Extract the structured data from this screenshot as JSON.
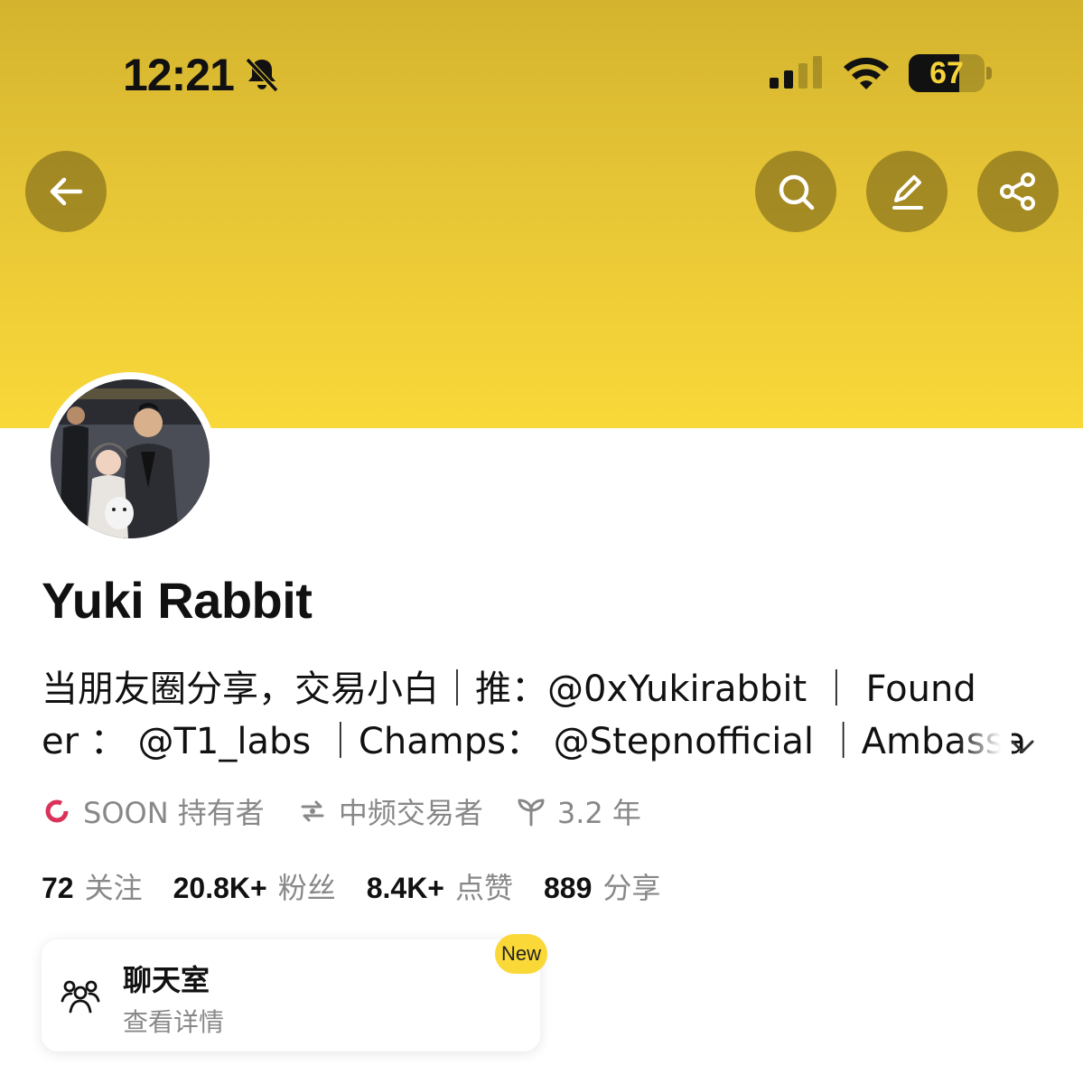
{
  "status_bar": {
    "time": "12:21",
    "battery": "67",
    "battery_level": 0.67,
    "icons": [
      "bell-slash-icon",
      "cellular-signal-icon",
      "wifi-icon",
      "battery-icon"
    ]
  },
  "header": {
    "back_icon": "arrow-left-icon",
    "actions": [
      "search-icon",
      "edit-pencil-icon",
      "share-icon"
    ]
  },
  "colors": {
    "banner_top": "#d4b42e",
    "banner_bottom": "#f9d839",
    "accent": "#f9d838",
    "muted_text": "#888888"
  },
  "profile": {
    "name": "Yuki Rabbit",
    "bio_line1": "当朋友圈分享，交易小白｜推：@0xYukirabbit ｜ Found",
    "bio_line2": "er ： @T1_labs ｜Champs： @Stepnofficial ｜Ambassa",
    "tags": [
      {
        "icon": "soon-ring-icon",
        "label": "SOON 持有者"
      },
      {
        "icon": "swap-exchange-icon",
        "label": "中频交易者"
      },
      {
        "icon": "sprout-icon",
        "label": "3.2 年"
      }
    ],
    "stats": [
      {
        "value": "72",
        "label": "关注"
      },
      {
        "value": "20.8K+",
        "label": "粉丝"
      },
      {
        "value": "8.4K+",
        "label": "点赞"
      },
      {
        "value": "889",
        "label": "分享"
      }
    ]
  },
  "chat_room": {
    "title": "聊天室",
    "subtitle": "查看详情",
    "badge": "New"
  }
}
